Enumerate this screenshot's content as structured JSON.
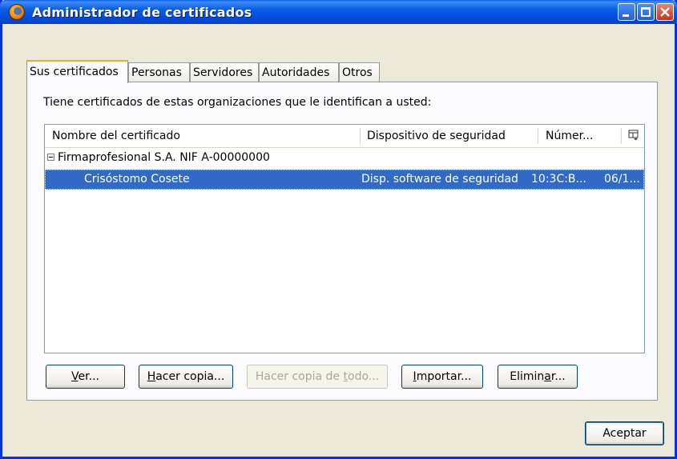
{
  "window": {
    "title": "Administrador de certificados",
    "title_icon": "firefox-icon",
    "controls": [
      "minimize-icon",
      "maximize-icon",
      "close-icon"
    ]
  },
  "tabs": [
    {
      "label": "Sus certificados",
      "active": true
    },
    {
      "label": "Personas",
      "active": false
    },
    {
      "label": "Servidores",
      "active": false
    },
    {
      "label": "Autoridades",
      "active": false
    },
    {
      "label": "Otros",
      "active": false
    }
  ],
  "description": "Tiene certificados de estas organizaciones que le identifican a usted:",
  "table": {
    "columns": [
      "Nombre del certificado",
      "Dispositivo de seguridad",
      "Númer...",
      ""
    ],
    "column_picker_icon": "column-picker-icon",
    "group": {
      "name": "Firmaprofesional S.A. NIF A-00000000",
      "expanded": true
    },
    "rows": [
      {
        "name": "Crisóstomo Cosete",
        "device": "Disp. software de seguridad",
        "serial": "10:3C:B...",
        "expires": "06/1...",
        "selected": true
      }
    ]
  },
  "buttons": {
    "view": {
      "pre": "",
      "key": "V",
      "post": "er..."
    },
    "backup": {
      "pre": "",
      "key": "H",
      "post": "acer copia..."
    },
    "backup_all": {
      "pre": "Hacer copia de ",
      "key": "t",
      "post": "odo..."
    },
    "import": {
      "pre": "",
      "key": "I",
      "post": "mportar..."
    },
    "delete": {
      "pre": "Elimin",
      "key": "a",
      "post": "r..."
    },
    "accept": "Aceptar"
  },
  "colors": {
    "selection": "#316ac5",
    "titlebar": "#0a5ce6",
    "active_tab_accent": "#f8a238"
  }
}
